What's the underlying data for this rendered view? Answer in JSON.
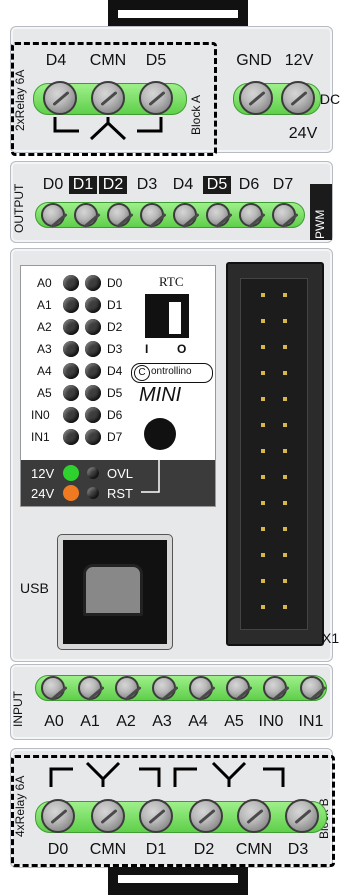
{
  "top_block": {
    "side_label": "2xRelay 6A",
    "pins": [
      "D4",
      "CMN",
      "D5"
    ],
    "block_label": "Block A",
    "power_pins": [
      "GND",
      "12V"
    ],
    "dc_label": "DC",
    "v24_label": "24V"
  },
  "output_block": {
    "side_label": "OUTPUT",
    "pins": [
      "D0",
      "D1",
      "D2",
      "D3",
      "D4",
      "D5",
      "D6",
      "D7"
    ],
    "inverted_pins": [
      "D1",
      "D2",
      "D5"
    ],
    "pwm_label": "PWM"
  },
  "panel": {
    "leds_left": [
      "A0",
      "A1",
      "A2",
      "A3",
      "A4",
      "A5",
      "IN0",
      "IN1"
    ],
    "leds_right": [
      "D0",
      "D1",
      "D2",
      "D3",
      "D4",
      "D5",
      "D6",
      "D7"
    ],
    "rtc_label": "RTC",
    "switch_off": "I",
    "switch_on": "O",
    "brand": "ontrollino",
    "model": "MINI",
    "power_12v": "12V",
    "power_24v": "24V",
    "ovl": "OVL",
    "rst": "RST"
  },
  "usb_label": "USB",
  "connector_label": "X1",
  "input_block": {
    "side_label": "INPUT",
    "pins": [
      "A0",
      "A1",
      "A2",
      "A3",
      "A4",
      "A5",
      "IN0",
      "IN1"
    ]
  },
  "bottom_block": {
    "side_label": "4xRelay 6A",
    "pins": [
      "D0",
      "CMN",
      "D1",
      "D2",
      "CMN",
      "D3"
    ],
    "block_label": "Block B"
  },
  "colors": {
    "terminal_green": "#5fcf4a",
    "led_green": "#2ed12e",
    "led_orange": "#f07a22"
  }
}
